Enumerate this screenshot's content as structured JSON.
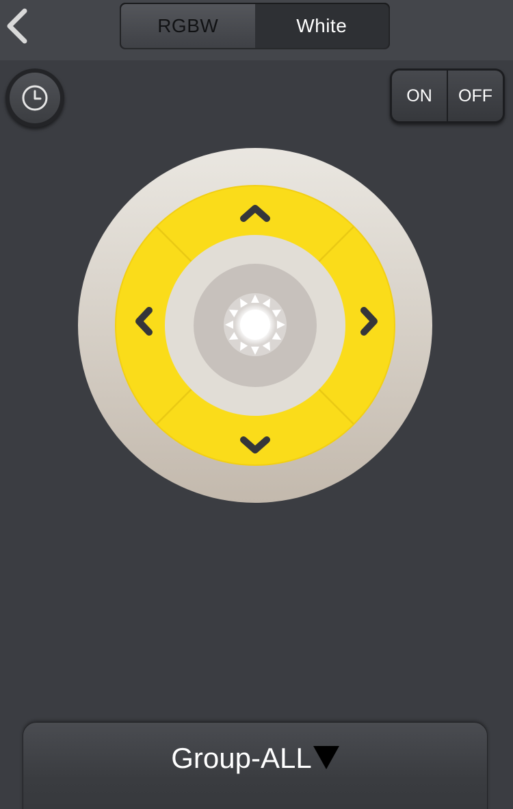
{
  "header": {
    "back_icon": "chevron-left-icon",
    "tabs": [
      {
        "label": "RGBW",
        "selected": false
      },
      {
        "label": "White",
        "selected": true
      }
    ]
  },
  "controls": {
    "timer_icon": "clock-icon",
    "power": {
      "on_label": "ON",
      "off_label": "OFF"
    }
  },
  "dial": {
    "ring_color": "#fadc1a",
    "up_icon": "chevron-up-icon",
    "down_icon": "chevron-down-icon",
    "left_icon": "chevron-left-icon",
    "right_icon": "chevron-right-icon",
    "center_icon": "sun-icon"
  },
  "group": {
    "label": "Group-ALL",
    "caret_icon": "caret-down-icon"
  }
}
